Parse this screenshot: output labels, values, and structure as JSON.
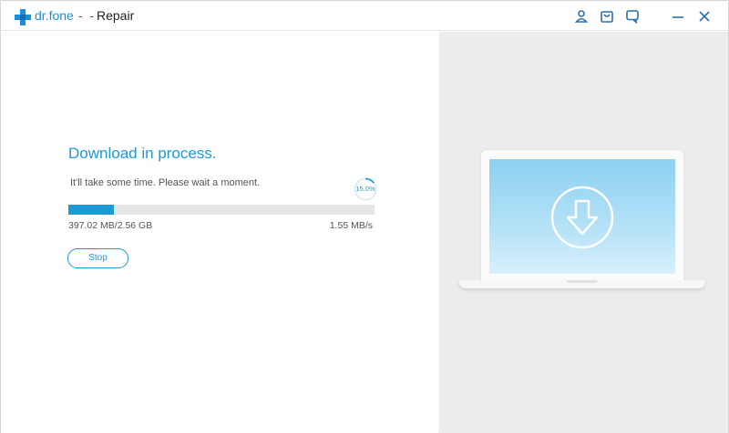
{
  "titlebar": {
    "brand": "dr.fone",
    "separator": "- -",
    "module": "Repair",
    "icons": [
      "user-icon",
      "cart-icon",
      "feedback-icon",
      "minimize-icon",
      "close-icon"
    ],
    "accent_color": "#1a90d9"
  },
  "download": {
    "heading": "Download in process.",
    "subtitle": "It'll take some time. Please wait a moment.",
    "percent_label": "15.0%",
    "progress_fraction": 0.15,
    "size_text": "397.02 MB/2.56 GB",
    "speed_text": "1.55 MB/s",
    "stop_label": "Stop"
  },
  "illustration": {
    "icon": "download-arrow-icon",
    "screen_gradient": [
      "#8dd1f2",
      "#d8f0fb"
    ]
  }
}
